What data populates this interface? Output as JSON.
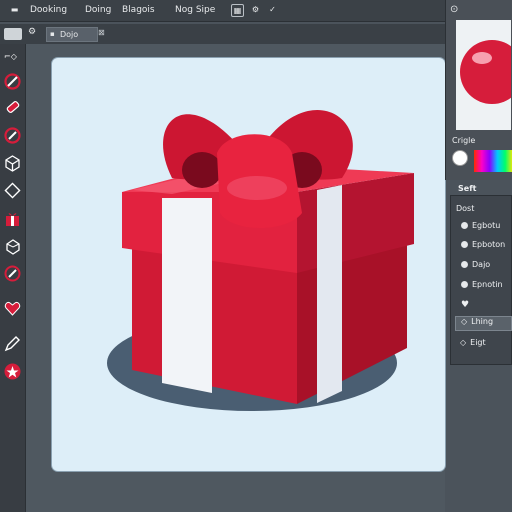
{
  "menu": {
    "items": [
      "Dooking",
      "Doing",
      "Blagois",
      "Nog Sipe"
    ]
  },
  "tab": {
    "label": "Dojo"
  },
  "props": {
    "title": "Crigle",
    "swatch_label": "Seft",
    "section": "Dost",
    "rows": [
      "Egbotu",
      "Epboton",
      "Dajo",
      "Epnotin",
      "",
      "Lhing",
      "Eigt"
    ]
  },
  "colors": {
    "accent": "#d61d3b",
    "ribbon": "#f2f4f8",
    "canvas": "#ddeef8"
  }
}
